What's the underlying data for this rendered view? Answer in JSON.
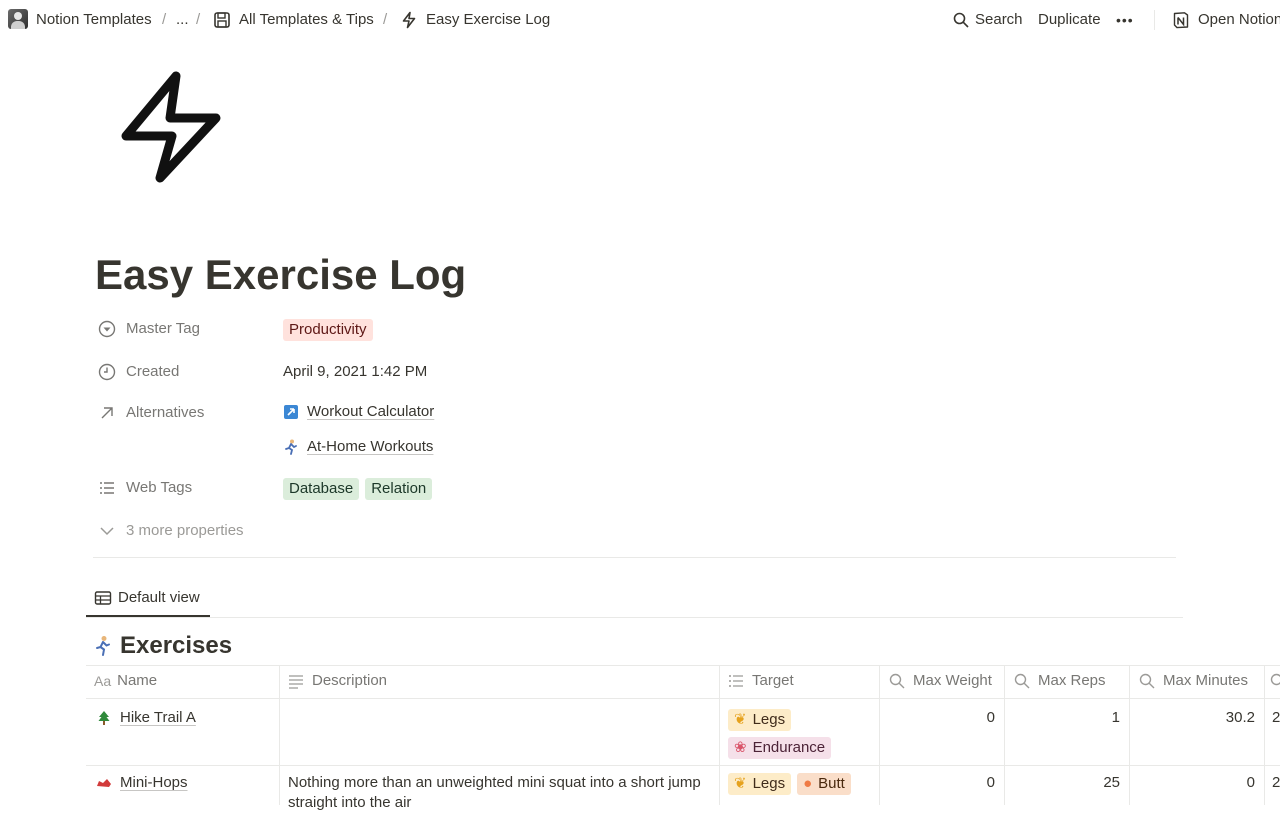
{
  "breadcrumb": {
    "workspace": "Notion Templates",
    "ellipsis": "...",
    "section": "All Templates & Tips",
    "page": "Easy Exercise Log",
    "separator": "/"
  },
  "topbar_actions": {
    "search": "Search",
    "duplicate": "Duplicate",
    "more": "•••",
    "open": "Open Notion"
  },
  "page": {
    "title": "Easy Exercise Log",
    "icon": "lightning-bolt-icon"
  },
  "properties": {
    "master_tag": {
      "label": "Master Tag",
      "value": "Productivity"
    },
    "created": {
      "label": "Created",
      "value": "April 9, 2021 1:42 PM"
    },
    "alternatives": {
      "label": "Alternatives",
      "items": [
        "Workout Calculator",
        "At-Home Workouts"
      ]
    },
    "web_tags": {
      "label": "Web Tags",
      "items": [
        "Database",
        "Relation"
      ]
    },
    "more": "3 more properties"
  },
  "view": {
    "tab": "Default view"
  },
  "database": {
    "title": "Exercises",
    "columns": [
      "Name",
      "Description",
      "Target",
      "Max Weight",
      "Max Reps",
      "Max Minutes"
    ],
    "rows": [
      {
        "name": "Hike Trail A",
        "description": "",
        "targets": [
          "Legs",
          "Endurance"
        ],
        "max_weight": "0",
        "max_reps": "1",
        "max_minutes": "30.2",
        "overflow": "2"
      },
      {
        "name": "Mini-Hops",
        "description": "Nothing more than an unweighted mini squat into a short jump straight into the air",
        "targets": [
          "Legs",
          "Butt"
        ],
        "max_weight": "0",
        "max_reps": "25",
        "max_minutes": "0",
        "overflow": "2"
      }
    ]
  },
  "colors": {
    "text": "#37352f",
    "muted": "#787774",
    "tag_red": "#ffe2dd",
    "tag_green": "#dbeddb",
    "tag_yellow": "#fdecc8",
    "tag_pink": "#f5e0e9",
    "tag_orange": "#fadec9"
  }
}
